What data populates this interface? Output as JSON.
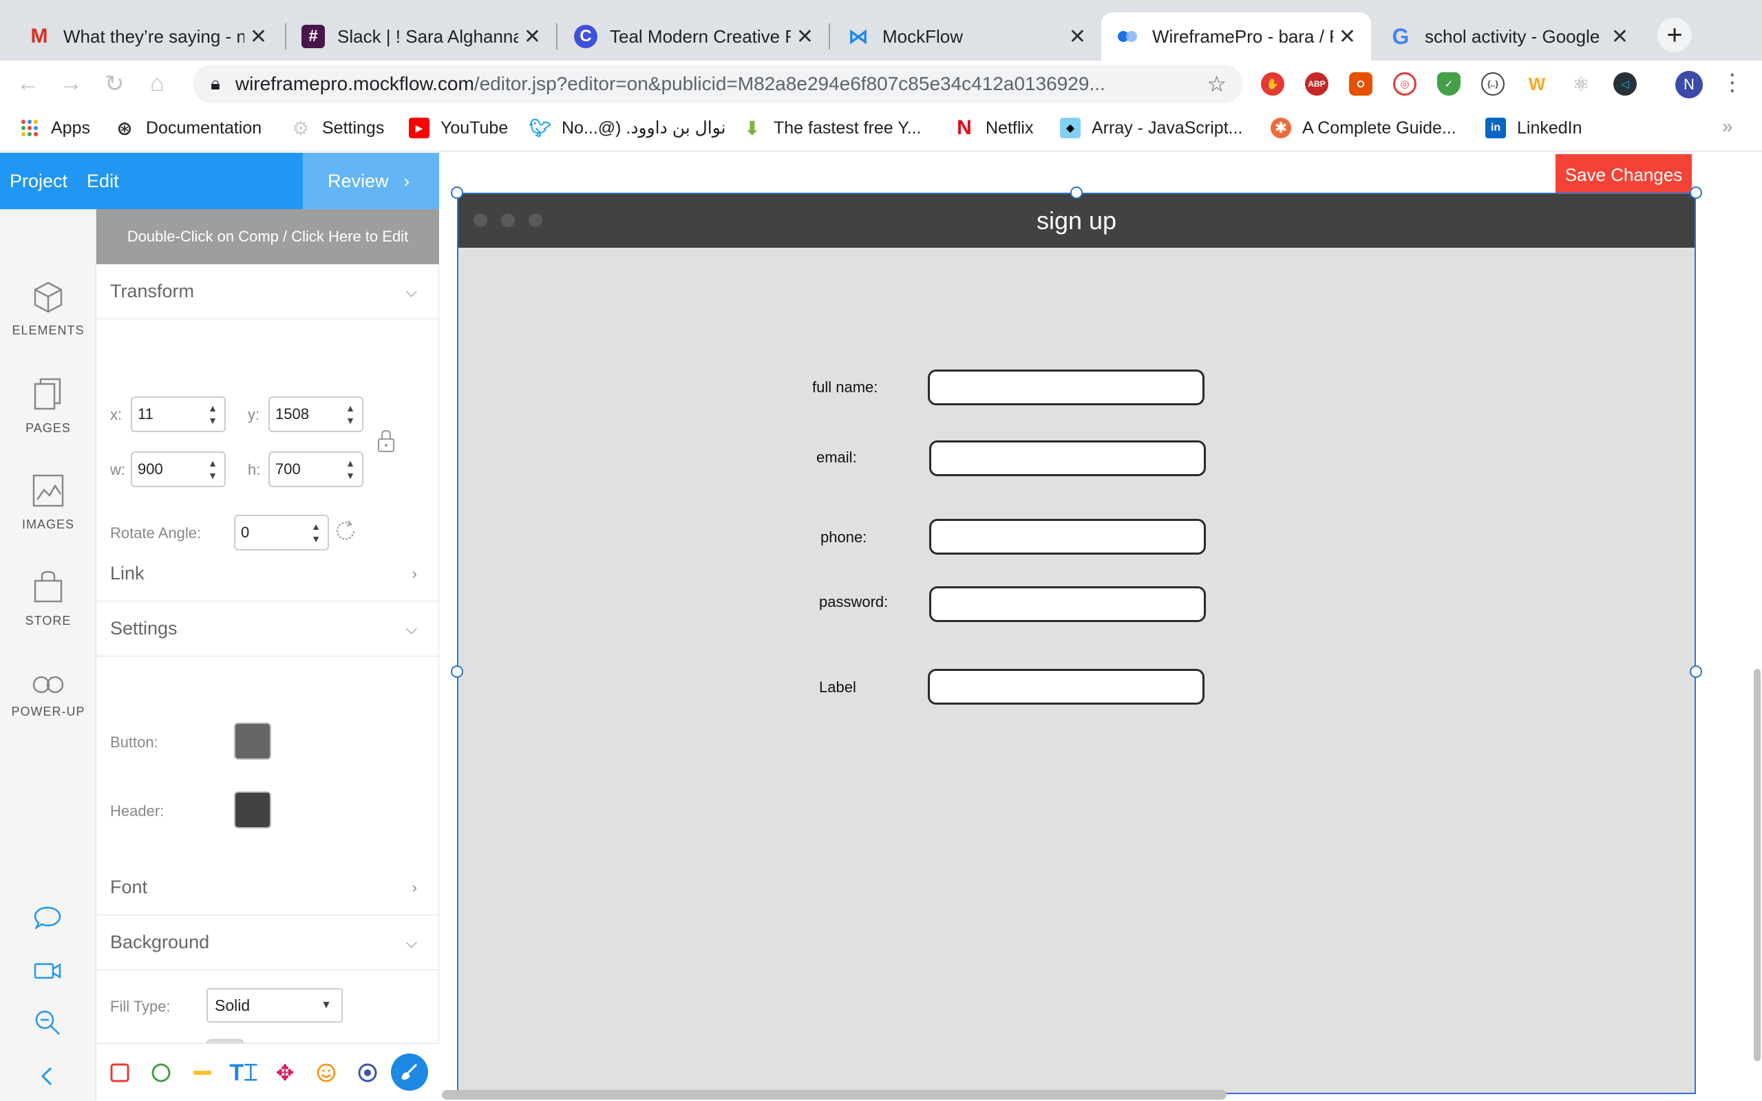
{
  "browser": {
    "tabs": [
      {
        "title": "What they’re saying - na",
        "favicon": "gmail-icon",
        "active": false
      },
      {
        "title": "Slack | ! Sara Alghannam",
        "favicon": "slack-icon",
        "active": false
      },
      {
        "title": "Teal Modern Creative Re",
        "favicon": "canva-icon",
        "active": false
      },
      {
        "title": "MockFlow",
        "favicon": "mockflow-icon",
        "active": false
      },
      {
        "title": "WireframePro - bara / P",
        "favicon": "wireframepro-icon",
        "active": true
      },
      {
        "title": "schol activity - Google S",
        "favicon": "google-icon",
        "active": false
      }
    ],
    "url_host": "wireframepro.mockflow.com",
    "url_path": "/editor.jsp?editor=on&publicid=M82a8e294e6f807c85e34c412a0136929...",
    "profile_initial": "N",
    "bookmarks": [
      {
        "label": "Apps",
        "icon": "apps-grid-icon"
      },
      {
        "label": "Documentation",
        "icon": "documentation-icon"
      },
      {
        "label": "Settings",
        "icon": "settings-icon"
      },
      {
        "label": "YouTube",
        "icon": "youtube-icon"
      },
      {
        "label": "No...@) .نوال بن داوود",
        "icon": "twitter-icon"
      },
      {
        "label": "The fastest free Y...",
        "icon": "download-icon"
      },
      {
        "label": "Netflix",
        "icon": "netflix-icon"
      },
      {
        "label": "Array - JavaScript...",
        "icon": "mdn-icon"
      },
      {
        "label": "A Complete Guide...",
        "icon": "asterisk-icon"
      },
      {
        "label": "LinkedIn",
        "icon": "linkedin-icon"
      }
    ]
  },
  "app": {
    "menu": {
      "project": "Project",
      "edit": "Edit",
      "review": "Review"
    },
    "save_button": "Save Changes",
    "nav": [
      {
        "label": "ELEMENTS",
        "icon": "cube-icon"
      },
      {
        "label": "PAGES",
        "icon": "pages-icon"
      },
      {
        "label": "IMAGES",
        "icon": "image-icon"
      },
      {
        "label": "STORE",
        "icon": "bag-icon"
      },
      {
        "label": "POWER-UP",
        "icon": "infinity-icon"
      }
    ],
    "props": {
      "edit_hint": "Double-Click on Comp / Click Here to Edit",
      "transform": {
        "heading": "Transform",
        "x_label": "x:",
        "x": "11",
        "y_label": "y:",
        "y": "1508",
        "w_label": "w:",
        "w": "900",
        "h_label": "h:",
        "h": "700",
        "rotate_label": "Rotate Angle:",
        "rotate": "0"
      },
      "link_heading": "Link",
      "settings": {
        "heading": "Settings",
        "button_label": "Button:",
        "button_color": "#666666",
        "header_label": "Header:",
        "header_color": "#424242"
      },
      "font_heading": "Font",
      "background": {
        "heading": "Background",
        "fill_label": "Fill Type:",
        "fill_value": "Solid",
        "fill_color": "#e0e0e0"
      }
    },
    "canvas": {
      "frame_title": "sign up",
      "fields": [
        {
          "label": "full name:"
        },
        {
          "label": "email:"
        },
        {
          "label": "phone:"
        },
        {
          "label": "password:"
        },
        {
          "label": "Label"
        }
      ]
    }
  }
}
